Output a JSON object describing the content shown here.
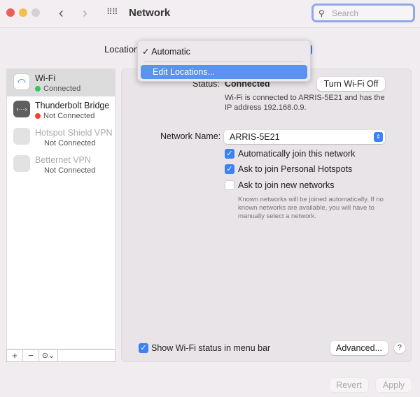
{
  "window": {
    "title": "Network"
  },
  "search": {
    "placeholder": "Search"
  },
  "location": {
    "label": "Location",
    "menu": [
      {
        "label": "Automatic",
        "checked": true
      },
      {
        "label": "Edit Locations...",
        "highlighted": true
      }
    ]
  },
  "sidebar": {
    "items": [
      {
        "name": "Wi-Fi",
        "status": "Connected",
        "status_color": "#34c759",
        "icon": "wifi-icon",
        "selected": true
      },
      {
        "name": "Thunderbolt Bridge",
        "status": "Not Connected",
        "status_color": "#ff3b30",
        "icon": "thunderbolt-bridge-icon"
      },
      {
        "name": "Hotspot Shield VPN",
        "status": "Not Connected",
        "icon": "lock-icon",
        "dimmed": true
      },
      {
        "name": "Betternet VPN",
        "status": "Not Connected",
        "icon": "lock-icon",
        "dimmed": true
      }
    ],
    "add": "+",
    "remove": "−",
    "action": "⊙⌄"
  },
  "detail": {
    "status_label": "Status:",
    "status_value": "Connected",
    "turn_off": "Turn Wi-Fi Off",
    "status_desc_1": "Wi-Fi is connected to ARRIS-5E21 and has the",
    "status_desc_2": "IP address 192.168.0.9.",
    "network_label": "Network Name:",
    "network_value": "ARRIS-5E21",
    "auto_join": "Automatically join this network",
    "hotspots": "Ask to join Personal Hotspots",
    "new_networks": "Ask to join new networks",
    "hint_1": "Known networks will be joined automatically. If no",
    "hint_2": "known networks are available, you will have to",
    "hint_3": "manually select a network.",
    "menubar": "Show Wi-Fi status in menu bar",
    "advanced": "Advanced...",
    "help": "?"
  },
  "footer": {
    "revert": "Revert",
    "apply": "Apply"
  }
}
